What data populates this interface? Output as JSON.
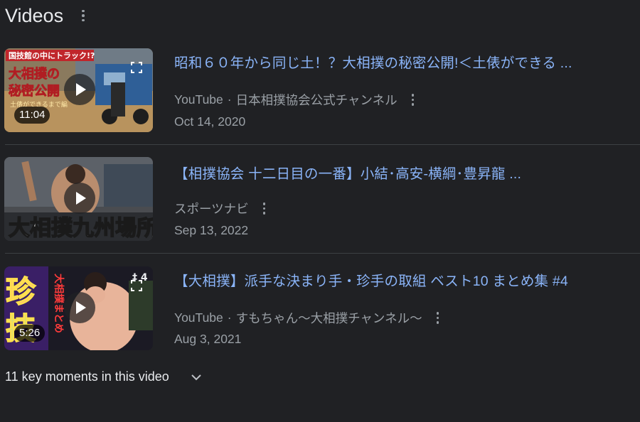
{
  "section": {
    "title": "Videos",
    "menu_icon": "more-vert-icon"
  },
  "videos": [
    {
      "title": "昭和６０年から同じ土！？大相撲の秘密公開!＜土俵ができる ...",
      "source": "YouTube",
      "channel": "日本相撲協会公式チャンネル",
      "date": "Oct 14, 2020",
      "duration": "11:04",
      "thumbnail_text": [
        "国技館の中にトラック!?",
        "大相撲の",
        "秘密公開",
        "土俵ができるまで編"
      ]
    },
    {
      "title": "【相撲協会 十二日目の一番】小結･高安-横綱･豊昇龍 ...",
      "source": "",
      "channel": "スポーツナビ",
      "date": "Sep 13, 2022",
      "duration": "",
      "thumbnail_text": [
        "大相撲九州場所"
      ]
    },
    {
      "title": "【大相撲】派手な決まり手・珍手の取組 ベスト10 まとめ集 #4",
      "source": "YouTube",
      "channel": "すもちゃん～大相撲チャンネル～",
      "date": "Aug 3, 2021",
      "duration": "5:26",
      "thumbnail_text": [
        "珍",
        "技",
        "大相撲まとめ"
      ]
    }
  ],
  "key_moments": {
    "label": "11 key moments in this video",
    "icon": "chevron-down-icon"
  },
  "colors": {
    "background": "#202124",
    "link": "#8ab4f8",
    "secondary_text": "#9aa0a6",
    "primary_text": "#e8eaed"
  }
}
